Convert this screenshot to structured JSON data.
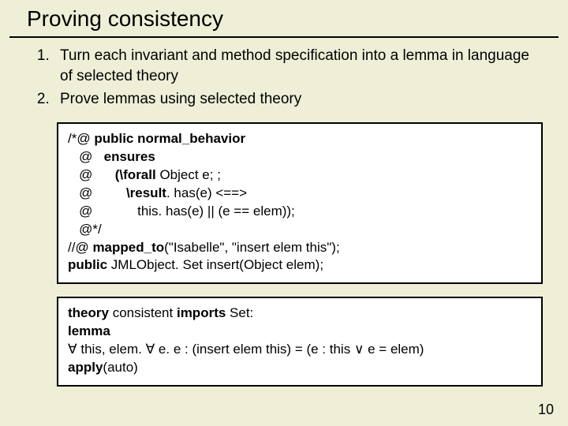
{
  "title": "Proving consistency",
  "steps": [
    "Turn each invariant and method specification into a lemma in language of selected theory",
    "Prove lemmas using selected theory"
  ],
  "codebox": {
    "l1a": "/*@ ",
    "l1b": "public normal_behavior",
    "l2a": "   @   ",
    "l2b": "ensures",
    "l3a": "   @      ",
    "l3b": "(\\forall",
    "l3c": " Object e; ;",
    "l4a": "   @         ",
    "l4b": "\\result",
    "l4c": ". has(e) <==>",
    "l5": "   @            this. has(e) || (e == elem));",
    "l6": "   @*/",
    "l7a": "//@ ",
    "l7b": "mapped_to",
    "l7c": "(\"Isabelle\", \"insert elem this\");",
    "l8a": "public",
    "l8b": " JMLObject. Set insert(Object elem);"
  },
  "theorybox": {
    "t1a": "theory",
    "t1b": " consistent ",
    "t1c": "imports",
    "t1d": " Set:",
    "t2": "lemma",
    "t3a": "∀",
    "t3b": " this, elem. ",
    "t3c": "∀",
    "t3d": " e. e : (insert elem this) = (e : this ",
    "t3e": "∨",
    "t3f": " e = elem)",
    "t4a": "apply",
    "t4b": "(auto)"
  },
  "page": "10"
}
